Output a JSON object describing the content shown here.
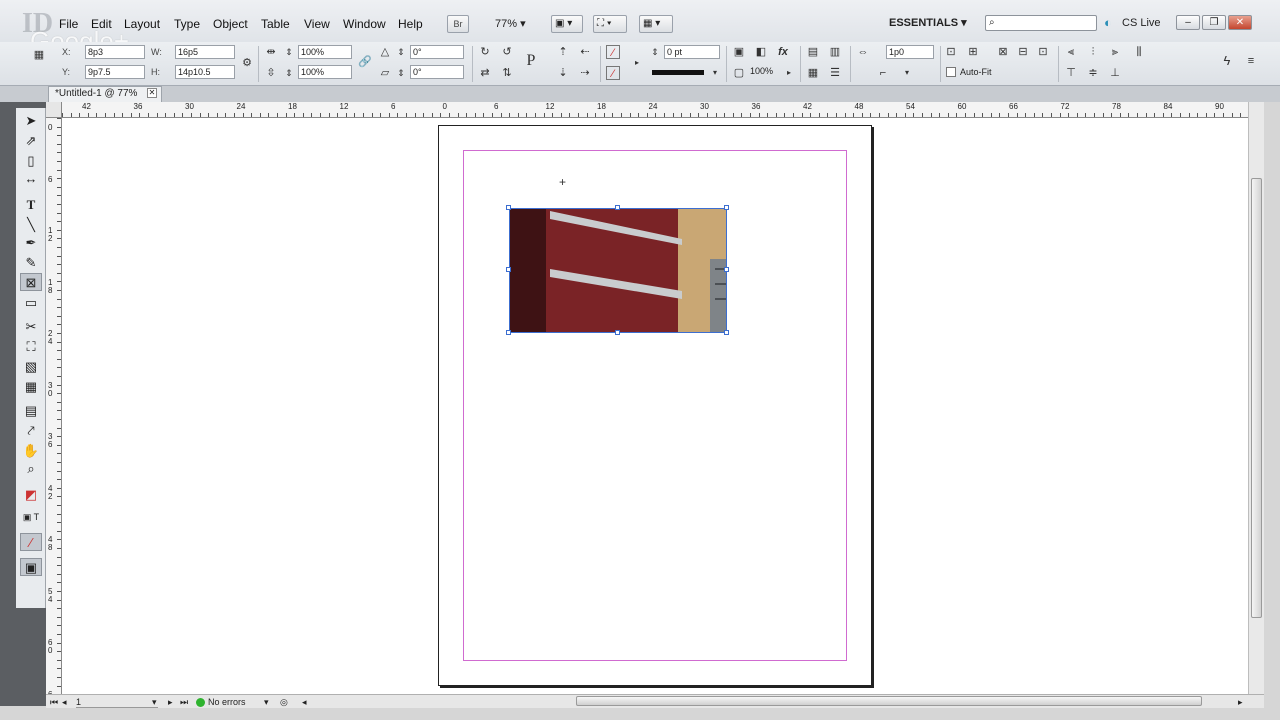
{
  "app": {
    "logo": "ID",
    "watermark": "Google+"
  },
  "menu": {
    "items": [
      "File",
      "Edit",
      "Layout",
      "Type",
      "Object",
      "Table",
      "View",
      "Window",
      "Help"
    ],
    "bridge_label": "Br",
    "zoom": "77%",
    "workspace": "ESSENTIALS",
    "cs_live": "CS Live",
    "window_min": "–",
    "window_restore": "❐",
    "window_close": "✕"
  },
  "control": {
    "x_label": "X:",
    "x_value": "8p3",
    "y_label": "Y:",
    "y_value": "9p7.5",
    "w_label": "W:",
    "w_value": "16p5",
    "h_label": "H:",
    "h_value": "14p10.5",
    "scale_x": "100%",
    "scale_y": "100%",
    "rotate": "0°",
    "shear": "0°",
    "stroke_weight": "0 pt",
    "opacity": "100%",
    "spacing": "1p0",
    "auto_fit": "Auto-Fit"
  },
  "tab": {
    "title": "*Untitled-1 @ 77%",
    "close": "✕"
  },
  "ruler": {
    "h_labels": [
      "42",
      "36",
      "30",
      "24",
      "18",
      "12",
      "6",
      "0",
      "6",
      "12",
      "18",
      "24",
      "30",
      "36",
      "42",
      "48",
      "54",
      "60",
      "66",
      "72",
      "78",
      "84",
      "90"
    ],
    "v_labels": [
      "0",
      "6",
      "1 2",
      "1 8",
      "2 4",
      "3 0",
      "3 6",
      "4 2",
      "4 8",
      "5 4",
      "6 0",
      "6 6"
    ]
  },
  "status": {
    "page_number": "1",
    "preflight": "No errors"
  },
  "colors": {
    "margin_guide": "#d06bd0",
    "frame_selection": "#3c6ed0",
    "status_ok": "#2fb32f"
  }
}
